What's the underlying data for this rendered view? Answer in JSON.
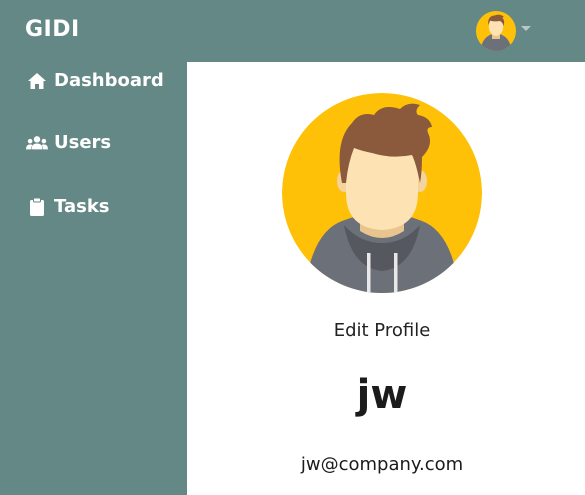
{
  "header": {
    "brand": "GIDI",
    "avatar_icon": "user-avatar-icon",
    "menu_icon": "caret-down-icon"
  },
  "sidebar": {
    "items": [
      {
        "label": "Dashboard",
        "icon": "home-icon"
      },
      {
        "label": "Users",
        "icon": "users-icon"
      },
      {
        "label": "Tasks",
        "icon": "clipboard-icon"
      }
    ]
  },
  "profile": {
    "edit_label": "Edit Profile",
    "username": "jw",
    "email": "jw@company.com"
  },
  "colors": {
    "sidebar_bg": "#648886",
    "content_bg": "#ffffff",
    "avatar_bg": "#FFC107",
    "hair": "#8B5A3C",
    "skin": "#FDE2B3",
    "hoodie": "#6C7079"
  }
}
